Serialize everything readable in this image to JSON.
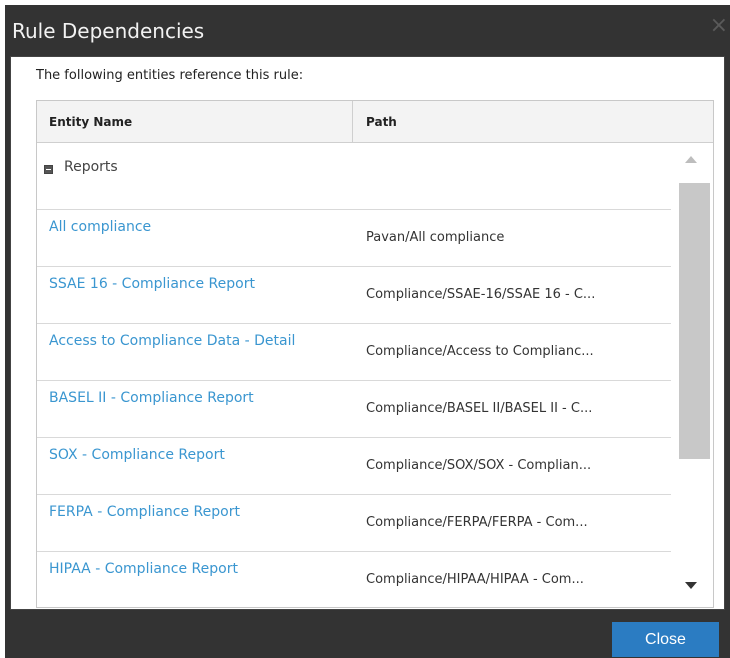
{
  "dialog": {
    "title": "Rule Dependencies",
    "intro": "The following entities reference this rule:",
    "close_label": "Close"
  },
  "grid": {
    "columns": [
      "Entity Name",
      "Path"
    ],
    "group": "Reports",
    "rows": [
      {
        "name": "All compliance",
        "path": "Pavan/All compliance"
      },
      {
        "name": "SSAE 16 - Compliance Report",
        "path": "Compliance/SSAE-16/SSAE 16 - C..."
      },
      {
        "name": "Access to Compliance Data - Detail",
        "path": "Compliance/Access to Complianc..."
      },
      {
        "name": "BASEL II - Compliance Report",
        "path": "Compliance/BASEL II/BASEL II - C..."
      },
      {
        "name": "SOX - Compliance Report",
        "path": "Compliance/SOX/SOX - Complian..."
      },
      {
        "name": "FERPA - Compliance Report",
        "path": "Compliance/FERPA/FERPA - Com..."
      },
      {
        "name": "HIPAA - Compliance Report",
        "path": "Compliance/HIPAA/HIPAA - Com..."
      }
    ]
  },
  "icons": {
    "close": "close-icon",
    "collapse": "collapse-icon",
    "scroll_up": "scroll-up-icon",
    "scroll_down": "scroll-down-icon"
  },
  "colors": {
    "titlebar": "#333333",
    "link": "#3a96d0",
    "button": "#2b7cc2"
  }
}
